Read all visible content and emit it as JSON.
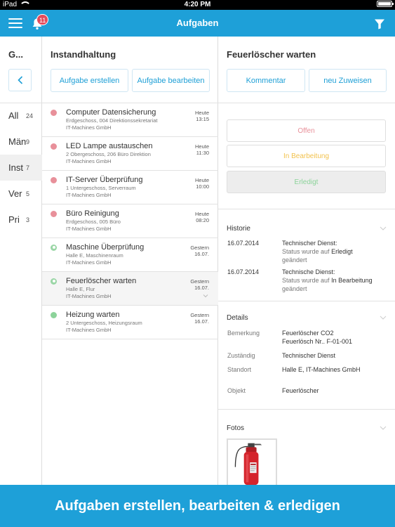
{
  "status_bar": {
    "device": "iPad",
    "time": "4:20 PM"
  },
  "nav": {
    "title": "Aufgaben",
    "notification_count": "11"
  },
  "groups": {
    "title": "G...",
    "items": [
      {
        "label": "All",
        "count": "24"
      },
      {
        "label": "Män",
        "count": "9"
      },
      {
        "label": "Inst",
        "count": "7"
      },
      {
        "label": "Ver",
        "count": "5"
      },
      {
        "label": "Pri",
        "count": "3"
      }
    ]
  },
  "tasks_panel": {
    "title": "Instandhaltung",
    "create_label": "Aufgabe erstellen",
    "edit_label": "Aufgabe bearbeiten",
    "tasks": [
      {
        "name": "Computer Datensicherung",
        "location": "Erdgeschoss, 004 Direktionssekretariat",
        "company": "IT-Machines GmbH",
        "day": "Heute",
        "time": "13:15",
        "status": "open"
      },
      {
        "name": "LED Lampe austauschen",
        "location": "2 Obergeschoss, 206 Büro Direktion",
        "company": "IT-Machines GmbH",
        "day": "Heute",
        "time": "11:30",
        "status": "open"
      },
      {
        "name": "IT-Server Überprüfung",
        "location": "1 Untergeschoss, Serverraum",
        "company": "IT-Machines GmbH",
        "day": "Heute",
        "time": "10:00",
        "status": "open"
      },
      {
        "name": "Büro Reinigung",
        "location": "Erdgeschoss, 005 Büro",
        "company": "IT-Machines GmbH",
        "day": "Heute",
        "time": "08:20",
        "status": "open"
      },
      {
        "name": "Maschine Überprüfung",
        "location": "Halle E, Maschinenraum",
        "company": "IT-Machines GmbH",
        "day": "Gestern",
        "time": "16.07.",
        "status": "user"
      },
      {
        "name": "Feuerlöscher warten",
        "location": "Halle E, Flur",
        "company": "IT-Machines GmbH",
        "day": "Gestern",
        "time": "16.07.",
        "status": "user"
      },
      {
        "name": "Heizung warten",
        "location": "2 Untergeschoss, Heizungsraum",
        "company": "IT-Machines GmbH",
        "day": "Gestern",
        "time": "16.07.",
        "status": "done"
      }
    ]
  },
  "detail": {
    "title": "Feuerlöscher warten",
    "comment_label": "Kommentar",
    "reassign_label": "neu Zuweisen",
    "status_open": "Offen",
    "status_progress": "In Bearbeitung",
    "status_done": "Erledigt",
    "history_title": "Historie",
    "history": [
      {
        "date": "16.07.2014",
        "who": "Technischer Dienst:",
        "text": "Status wurde auf",
        "status": "Erledigt",
        "suffix": "geändert"
      },
      {
        "date": "16.07.2014",
        "who": "Technische Dienst:",
        "text": "Status wurde auf",
        "status": "In Bearbeitung",
        "suffix": "geändert"
      }
    ],
    "details_title": "Details",
    "details": {
      "remark_key": "Bemerkung",
      "remark_val1": "Feuerlöscher CO2",
      "remark_val2": "Feuerlösch Nr.. F-01-001",
      "resp_key": "Zuständig",
      "resp_val": "Technischer Dienst",
      "loc_key": "Standort",
      "loc_val": "Halle E, IT-Machines GmbH",
      "obj_key": "Objekt",
      "obj_val": "Feuerlöscher"
    },
    "photos_title": "Fotos"
  },
  "banner": {
    "text": "Aufgaben erstellen, bearbeiten & erledigen"
  },
  "colors": {
    "accent": "#1ea0d8",
    "open": "#e8909a",
    "progress": "#f2c24e",
    "done": "#8cd39a",
    "user": "#9ad6a6"
  }
}
